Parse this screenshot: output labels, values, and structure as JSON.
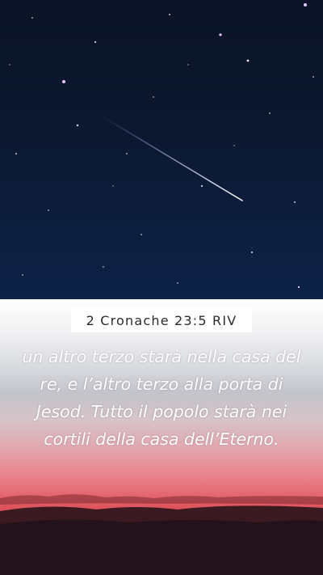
{
  "reference": "2 Cronache 23:5 RIV",
  "verse": "un altro terzo starà nella casa del re, e l’altro terzo alla porta di Jesod. Tutto il popolo starà nei cortili della casa dell’Eterno.",
  "colors": {
    "sky": "#0b1426",
    "meteor": "#cfd8ff",
    "sunset_red": "#e25a63",
    "text": "#ffffff"
  },
  "background": "night sky with shooting star over red sunset horizon"
}
